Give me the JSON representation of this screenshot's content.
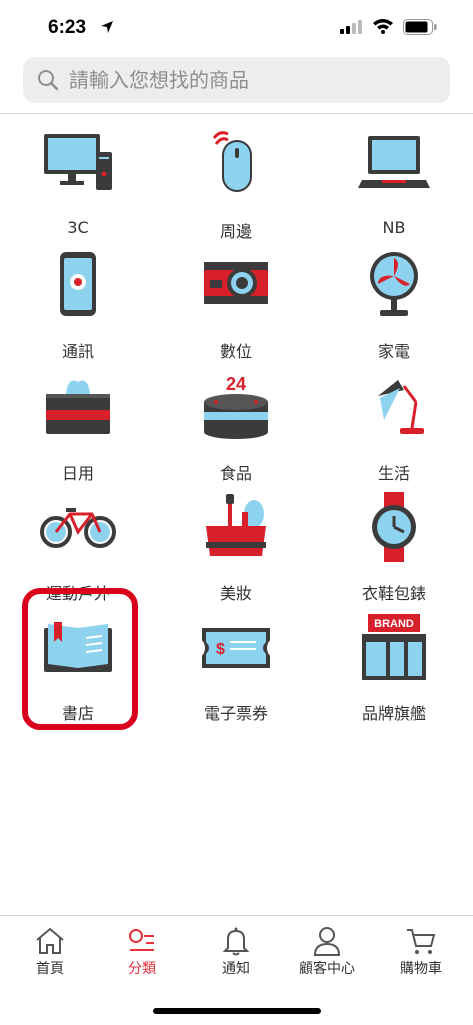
{
  "status_bar": {
    "time": "6:23"
  },
  "search": {
    "placeholder": "請輸入您想找的商品"
  },
  "categories": [
    {
      "label": "3C",
      "icon": "computer-icon"
    },
    {
      "label": "周邊",
      "icon": "mouse-icon"
    },
    {
      "label": "NB",
      "icon": "laptop-icon"
    },
    {
      "label": "通訊",
      "icon": "phone-icon"
    },
    {
      "label": "數位",
      "icon": "camera-icon"
    },
    {
      "label": "家電",
      "icon": "fan-icon"
    },
    {
      "label": "日用",
      "icon": "tissue-box-icon"
    },
    {
      "label": "食品",
      "icon": "cake-icon",
      "cake_text": "24"
    },
    {
      "label": "生活",
      "icon": "lamp-icon"
    },
    {
      "label": "運動戶外",
      "icon": "bicycle-icon"
    },
    {
      "label": "美妝",
      "icon": "makeup-icon"
    },
    {
      "label": "衣鞋包錶",
      "icon": "watch-icon"
    },
    {
      "label": "書店",
      "icon": "book-icon"
    },
    {
      "label": "電子票券",
      "icon": "ticket-icon"
    },
    {
      "label": "品牌旗艦",
      "icon": "brand-store-icon",
      "sign_text": "BRAND"
    }
  ],
  "highlighted_category": "書店",
  "tab_bar": [
    {
      "label": "首頁",
      "icon": "home-icon",
      "active": false
    },
    {
      "label": "分類",
      "icon": "category-icon",
      "active": true
    },
    {
      "label": "通知",
      "icon": "bell-icon",
      "active": false
    },
    {
      "label": "顧客中心",
      "icon": "person-icon",
      "active": false
    },
    {
      "label": "購物車",
      "icon": "cart-icon",
      "active": false
    }
  ],
  "colors": {
    "accent": "#e8313a",
    "icon_blue": "#8dd3f0",
    "icon_dark": "#3b3b3b",
    "icon_red": "#d8202a"
  }
}
